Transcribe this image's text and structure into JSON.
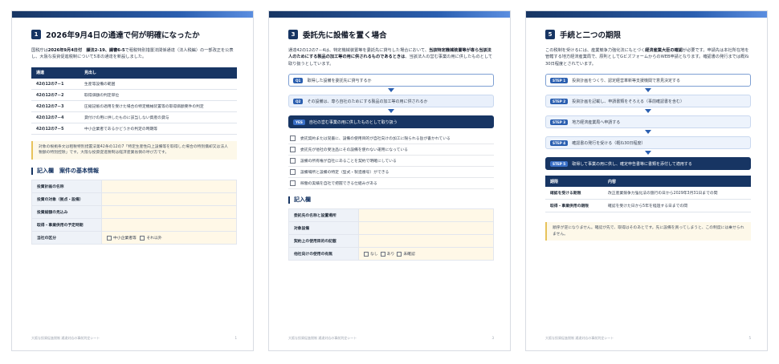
{
  "pages": [
    {
      "num": "1",
      "title": "2026年9月4日の通達で何が明確になったか",
      "para_a": "国税庁は",
      "para_b": "2026年9月4日付　課法2-19、課審6-5",
      "para_c": "で租税特別措置法関係通達（法人税編）の一部改正を公表し、大阪な投資促進税制について5本の通達を新設しました。",
      "table": {
        "headers": [
          "通達",
          "見出し"
        ],
        "rows": [
          [
            "42の12の7－1",
            "生産等設備の範囲"
          ],
          [
            "42の12の7－2",
            "取得価額の判定単位"
          ],
          [
            "42の12の7－3",
            "圧縮記帳の適用を受けた場合の特定機械装置等の取得価額要件の判定"
          ],
          [
            "42の12の7－4",
            "貸付けの用に供したものに該当しない資産の貸与"
          ],
          [
            "42の12の7－5",
            "中小企業者であるかどうかの判定の時期等"
          ]
        ]
      },
      "note": "対象の根拠条文は租税特別措置法第42条の12の7「特定生産性向上設備等を取得した場合の特別償却又は法人税額の特別控除」です。大阪な投資促進税制は経済産業省側の呼び方です。",
      "form_title": "記入欄　案件の基本情報",
      "form_rows": [
        "投資計画の名称",
        "投資の対象（拠点・設備）",
        "投資総額の見込み",
        "取得・事業供用の予定時期",
        "当社の区分"
      ],
      "form_options": [
        "中小企業者等",
        "それ以外"
      ],
      "footer_left": "大阪な投資促進税制 通達対応の事前判定シート",
      "footer_right": "1"
    },
    {
      "num": "3",
      "title": "委託先に設備を置く場合",
      "para_a": "通達42の12の7－4は、特定機械装置等を委託先に貸与した場合において、",
      "para_b": "当該特定機械装置等が専ら当該法人のためにする製品の加工等の用に供されるものであるときは",
      "para_c": "、当該法人の営む事業の用に供したものとして取り扱うとしています。",
      "flow": [
        {
          "badge": "Q1",
          "text": "取得した設備を委託先に貸与するか"
        },
        {
          "badge": "Q2",
          "text": "その設備は、専ら自社のためにする製品の加工等の用に供されるか"
        },
        {
          "badge": "YES",
          "text": "自社の営む事業の用に供したものとして取り扱う"
        }
      ],
      "checks": [
        "委託契約または覚書に、設備の使用目的が自社向けの加工に限られる旨が書かれている",
        "委託先が他社の受注品にその設備を使わない運用になっている",
        "設備の所有権が自社にあることを契約で明確にしている",
        "設備場所と設備の特定（型式・製造番号）ができる",
        "稼働の実績を自社で把握できる仕組みがある"
      ],
      "form_title": "記入欄",
      "form_rows": [
        "委託先の名称と設置場所",
        "対象設備",
        "契約上の使用目的の記載",
        "他社向けの使用の有無"
      ],
      "form_options": [
        "なし",
        "あり",
        "未確認"
      ],
      "footer_left": "大阪な投資促進税制 通達対応の事前判定シート",
      "footer_right": "3"
    },
    {
      "num": "5",
      "title": "手続と二つの期限",
      "para_a": "この税制を受けるには、産業競争力強化法にもとづく",
      "para_b": "経済産業大臣の確認",
      "para_c": "が必要です。申請先は本社所在地を管轄する地方経済産業局で、原則としてGビズフォームからのWEB申請となります。確認書の発行までは概ね30日程度とされています。",
      "steps": [
        {
          "badge": "STEP 1",
          "text": "投資計画をつくり、認定経営革新等支援機関で意見決定する"
        },
        {
          "badge": "STEP 2",
          "text": "投資計画を記載し、申請書類をそろえる（事前確認書を含む）"
        },
        {
          "badge": "STEP 3",
          "text": "地方経済産業局へ申請する"
        },
        {
          "badge": "STEP 4",
          "text": "確認書の発行を受ける（概ね30日程度）"
        },
        {
          "badge": "STEP 5",
          "text": "取得して事業の用に供し、確定申告書等に書類を添付して適用する"
        }
      ],
      "deadline": {
        "headers": [
          "期限",
          "内容"
        ],
        "rows": [
          [
            "確認を受ける期限",
            "改正産業競争力強化法の施行の日から2029年3月31日までの間"
          ],
          [
            "取得・事業供用の期限",
            "確認を受けた日から5年を経過する日までの間"
          ]
        ]
      },
      "note": "順序が逆になりません。確認が先で、取得はそのあとです。先に設備を買ってしまうと、この制度には乗せられません。",
      "footer_left": "大阪な投資促進税制 通達対応の事前判定シート",
      "footer_right": "5"
    }
  ]
}
